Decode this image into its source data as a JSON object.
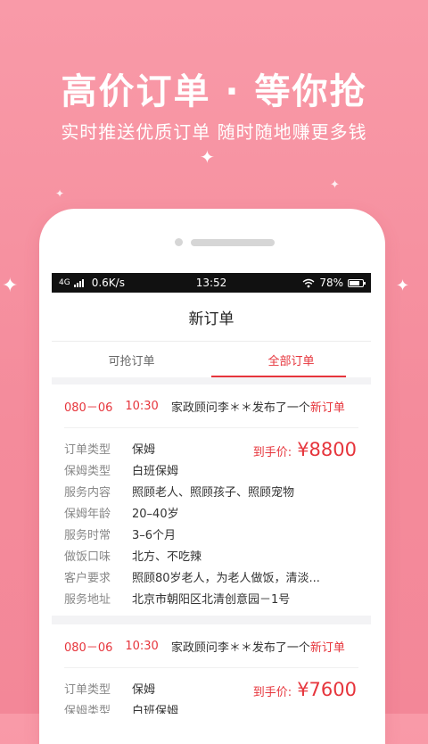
{
  "hero": {
    "title": "高价订单 · 等你抢",
    "subtitle": "实时推送优质订单 随时随地赚更多钱"
  },
  "colors": {
    "background": "#f48b9b",
    "accent": "#e6353c"
  },
  "status_bar": {
    "network": "4G",
    "speed": "0.6K/s",
    "time": "13:52",
    "battery": "78%",
    "battery_level": 0.78,
    "icons": [
      "signal-icon",
      "wifi-icon",
      "battery-icon"
    ]
  },
  "header": {
    "title": "新订单"
  },
  "tabs": [
    {
      "label": "可抢订单",
      "active": false
    },
    {
      "label": "全部订单",
      "active": true
    }
  ],
  "orders": [
    {
      "date": "080－06",
      "time": "10:30",
      "text": "家政顾问李＊＊发布了一个",
      "highlight": "新订单",
      "price_label": "到手价:",
      "price": "¥8800",
      "fields": [
        {
          "label": "订单类型",
          "value": "保姆"
        },
        {
          "label": "保姆类型",
          "value": "白班保姆"
        },
        {
          "label": "服务内容",
          "value": "照顾老人、照顾孩子、照顾宠物"
        },
        {
          "label": "保姆年龄",
          "value": "20–40岁"
        },
        {
          "label": "服务时常",
          "value": "3–6个月"
        },
        {
          "label": "做饭口味",
          "value": "北方、不吃辣"
        },
        {
          "label": "客户要求",
          "value": "照顾80岁老人，为老人做饭，清淡..."
        },
        {
          "label": "服务地址",
          "value": "北京市朝阳区北清创意园－1号"
        }
      ]
    },
    {
      "date": "080－06",
      "time": "10:30",
      "text": "家政顾问李＊＊发布了一个",
      "highlight": "新订单",
      "price_label": "到手价:",
      "price": "¥7600",
      "fields": [
        {
          "label": "订单类型",
          "value": "保姆"
        },
        {
          "label": "保姆类型",
          "value": "白班保姆"
        }
      ]
    }
  ]
}
